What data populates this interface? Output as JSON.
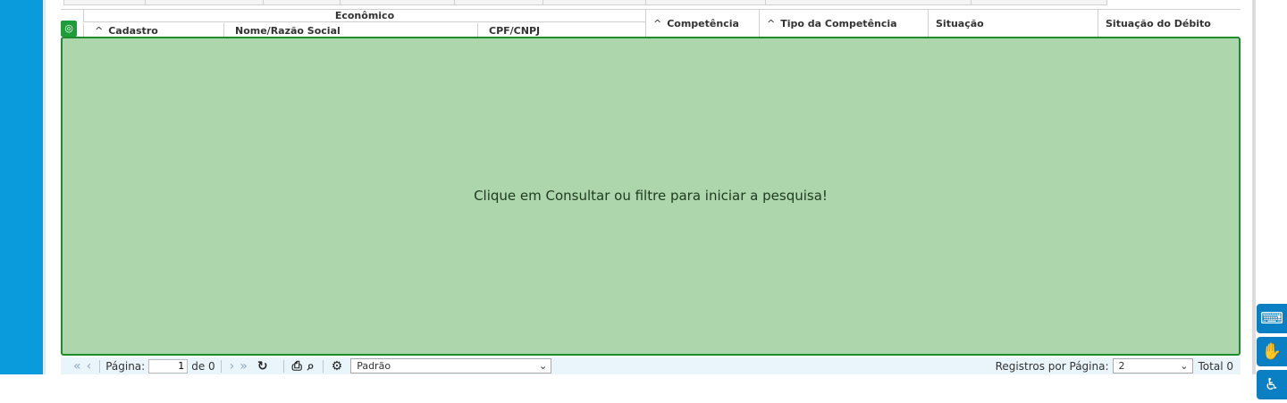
{
  "grid": {
    "group_header": "Econômico",
    "columns": {
      "cadastro": "Cadastro",
      "nome": "Nome/Razão Social",
      "cpf_cnpj": "CPF/CNPJ",
      "competencia": "Competência",
      "tipo_competencia": "Tipo da Competência",
      "situacao": "Situação",
      "situacao_debito": "Situação do Débito"
    },
    "sort_glyph": "^",
    "empty_message": "Clique em Consultar ou filtre para iniciar a pesquisa!"
  },
  "pager": {
    "page_label": "Página:",
    "page_value": "1",
    "of_label": "de 0",
    "layout_value": "Padrão",
    "rpp_label": "Registros por Página:",
    "rpp_value": "2",
    "total_label": "Total 0"
  },
  "colors": {
    "rail": "#0a9bdc",
    "panel_bg": "#add6ad",
    "panel_border": "#1d8c2a",
    "widget": "#0a7fc4"
  },
  "icons": {
    "grid_settings": "target-icon",
    "first_page": "double-chevron-left-icon",
    "prev_page": "chevron-left-icon",
    "next_page": "chevron-right-icon",
    "last_page": "double-chevron-right-icon",
    "refresh": "refresh-icon",
    "print": "print-icon",
    "search": "search-icon",
    "settings": "gear-icon",
    "keyboard": "keyboard-icon",
    "sign_language": "sign-language-icon",
    "accessibility": "accessibility-icon"
  }
}
